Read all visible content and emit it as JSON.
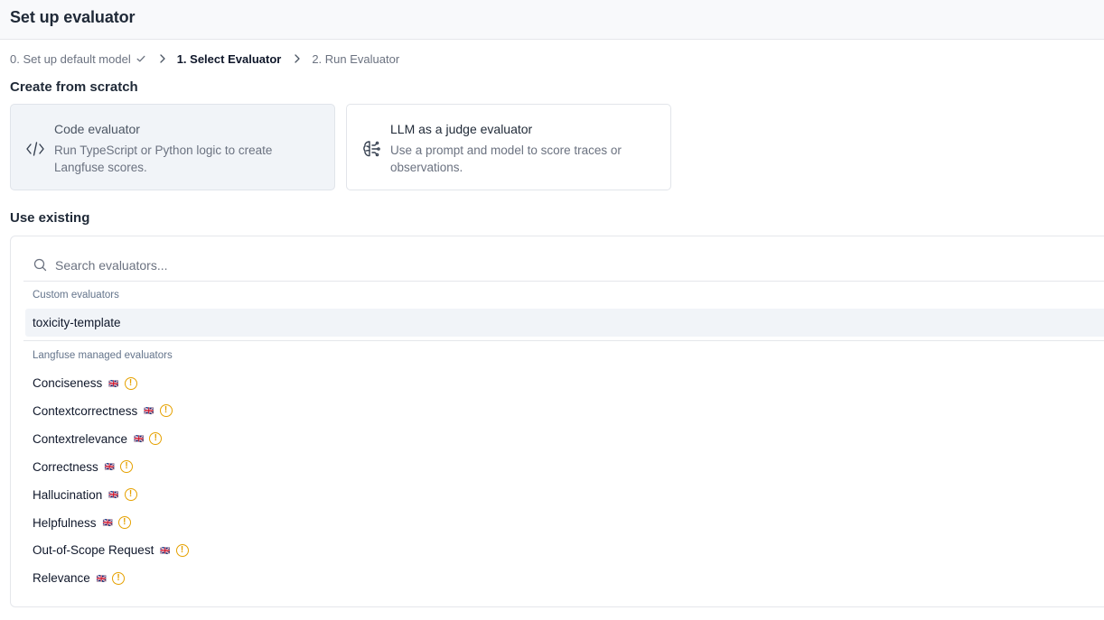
{
  "header": {
    "title": "Set up evaluator"
  },
  "breadcrumb": {
    "step0": "0. Set up default model",
    "step1": "1. Select Evaluator",
    "step2": "2. Run Evaluator"
  },
  "create": {
    "heading": "Create from scratch",
    "code_card": {
      "title": "Code evaluator",
      "desc": "Run TypeScript or Python logic to create Langfuse scores.",
      "icon": "code-icon"
    },
    "llm_card": {
      "title": "LLM as a judge evaluator",
      "desc": "Use a prompt and model to score traces or observations.",
      "icon": "brain-icon"
    }
  },
  "existing": {
    "heading": "Use existing",
    "search_placeholder": "Search evaluators...",
    "custom_heading": "Custom evaluators",
    "custom_items": [
      "toxicity-template"
    ],
    "managed_heading": "Langfuse managed evaluators",
    "managed_items": [
      "Conciseness",
      "Contextcorrectness",
      "Contextrelevance",
      "Correctness",
      "Hallucination",
      "Helpfulness",
      "Out-of-Scope Request",
      "Relevance"
    ],
    "managed_badge": "🇬🇧",
    "warning_glyph": "!"
  },
  "colors": {
    "accent_warning": "#e5a100",
    "selected_bg": "#f1f4f8",
    "border": "#e5e7eb"
  }
}
